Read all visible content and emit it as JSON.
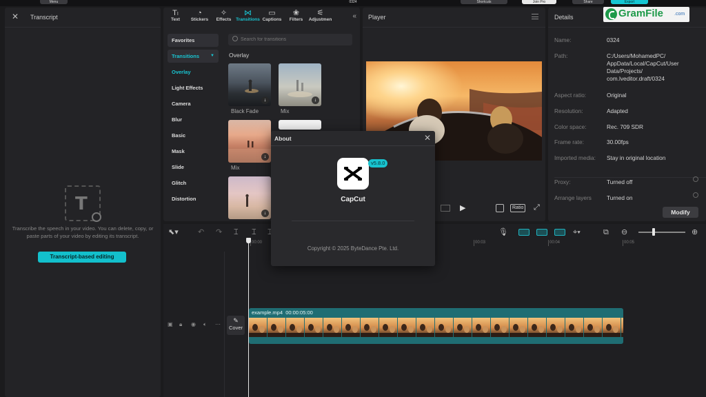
{
  "colors": {
    "accent": "#19c5d2",
    "panel": "#232326",
    "background": "#1b1b1d"
  },
  "topbar": {
    "chips": [
      "Menu",
      "0324",
      "Shortcuts",
      "Join Pro",
      "Share",
      "Export"
    ]
  },
  "transcript": {
    "title": "Transcript",
    "description": "Transcribe the speech in your video. You can delete, copy, or paste parts of your video by editing its transcript.",
    "button_label": "Transcript-based editing"
  },
  "media": {
    "tabs": [
      {
        "label": "Text",
        "icon": "text-icon"
      },
      {
        "label": "Stickers",
        "icon": "sticker-icon"
      },
      {
        "label": "Effects",
        "icon": "effects-icon"
      },
      {
        "label": "Transitions",
        "icon": "transitions-icon"
      },
      {
        "label": "Captions",
        "icon": "captions-icon"
      },
      {
        "label": "Filters",
        "icon": "filters-icon"
      },
      {
        "label": "Adjustmen",
        "icon": "adjustment-icon"
      }
    ],
    "sidebar": [
      {
        "label": "Favorites"
      },
      {
        "label": "Transitions"
      },
      {
        "label": "Overlay"
      },
      {
        "label": "Light Effects"
      },
      {
        "label": "Camera"
      },
      {
        "label": "Blur"
      },
      {
        "label": "Basic"
      },
      {
        "label": "Mask"
      },
      {
        "label": "Slide"
      },
      {
        "label": "Glitch"
      },
      {
        "label": "Distortion"
      }
    ],
    "search_placeholder": "Search for transitions",
    "section_title": "Overlay",
    "items": [
      {
        "label": "Black Fade"
      },
      {
        "label": "Mix"
      },
      {
        "label": "Mix"
      },
      {
        "label": ""
      },
      {
        "label": ""
      }
    ]
  },
  "player": {
    "title": "Player",
    "ratio_label": "Ratio"
  },
  "details": {
    "title": "Details",
    "rows": [
      {
        "key": "Name:",
        "value": "0324"
      },
      {
        "key": "Path:",
        "value": "C:/Users/MohamedPC/\nAppData/Local/CapCut/User\nData/Projects/\ncom.lveditor.draft/0324"
      },
      {
        "key": "Aspect ratio:",
        "value": "Original"
      },
      {
        "key": "Resolution:",
        "value": "Adapted"
      },
      {
        "key": "Color space:",
        "value": "Rec. 709 SDR"
      },
      {
        "key": "Frame rate:",
        "value": "30.00fps"
      },
      {
        "key": "Imported media:",
        "value": "Stay in original location"
      },
      {
        "key": "Proxy:",
        "value": "Turned off"
      },
      {
        "key": "Arrange layers",
        "value": "Turned on"
      }
    ],
    "modify_label": "Modify"
  },
  "watermark": {
    "text": "GramFile",
    "suffix": ".com"
  },
  "timeline": {
    "ruler": [
      "00:00",
      "00:03",
      "00:04",
      "00:05"
    ],
    "clip": {
      "name": "example.mp4",
      "duration": "00:00:05:00"
    },
    "cover_label": "Cover"
  },
  "about": {
    "title": "About",
    "app_name": "CapCut",
    "version": "v5.8.0",
    "copyright": "Copyright © 2025 ByteDance Pte. Ltd."
  }
}
